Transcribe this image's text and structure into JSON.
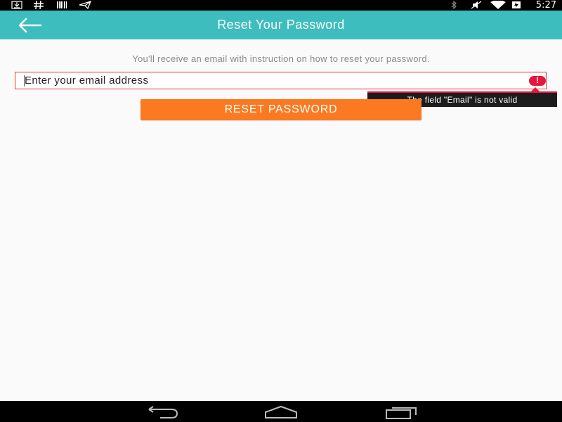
{
  "status_bar": {
    "icons": [
      "download-icon",
      "hash-icon",
      "barcode-icon",
      "send-icon",
      "bluetooth-icon",
      "mute-icon",
      "wifi-icon",
      "battery-icon"
    ],
    "time": "5:27"
  },
  "toolbar": {
    "back_icon": "arrow-left-icon",
    "title": "Reset Your Password",
    "background": "#3dbdbd"
  },
  "form": {
    "instruction": "You'll receive an email with instruction on how to reset your password.",
    "email": {
      "value": "",
      "placeholder": "Enter your email address",
      "error_icon": "error-icon",
      "error_message": "The field \"Email\" is not valid"
    },
    "reset_button_label": "RESET PASSWORD",
    "button_color": "#fb7a21",
    "error_color": "#e5173f"
  },
  "nav_bar": {
    "back": "nav-back-icon",
    "home": "nav-home-icon",
    "recents": "nav-recents-icon"
  }
}
